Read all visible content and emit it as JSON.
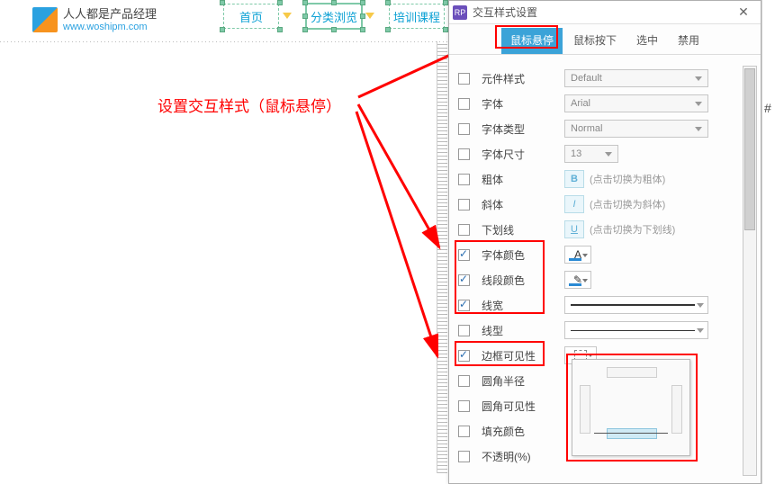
{
  "brand": {
    "title": "人人都是产品经理",
    "url": "www.woshipm.com"
  },
  "nav": {
    "items": [
      {
        "label": "首页"
      },
      {
        "label": "分类浏览",
        "selected": true
      },
      {
        "label": "培训课程"
      }
    ]
  },
  "annotation": "设置交互样式（鼠标悬停）",
  "dialog": {
    "app_badge": "RP",
    "title": "交互样式设置",
    "tabs": {
      "hover": "鼠标悬停",
      "mousedown": "鼠标按下",
      "selected": "选中",
      "disabled": "禁用"
    },
    "props": {
      "widget_style": {
        "label": "元件样式",
        "value": "Default"
      },
      "font_family": {
        "label": "字体",
        "value": "Arial"
      },
      "font_type": {
        "label": "字体类型",
        "value": "Normal"
      },
      "font_size": {
        "label": "字体尺寸",
        "value": "13"
      },
      "bold": {
        "label": "粗体",
        "btn": "B",
        "hint": "(点击切换为粗体)"
      },
      "italic": {
        "label": "斜体",
        "btn": "I",
        "hint": "(点击切换为斜体)"
      },
      "underline": {
        "label": "下划线",
        "btn": "U",
        "hint": "(点击切换为下划线)"
      },
      "font_color": {
        "label": "字体颜色",
        "glyph": "A"
      },
      "line_color": {
        "label": "线段颜色",
        "glyph": "✎"
      },
      "line_width": {
        "label": "线宽"
      },
      "line_style": {
        "label": "线型"
      },
      "border_visibility": {
        "label": "边框可见性"
      },
      "corner_radius": {
        "label": "圆角半径"
      },
      "corner_visibility": {
        "label": "圆角可见性"
      },
      "fill_color": {
        "label": "填充颜色"
      },
      "opacity": {
        "label": "不透明(%)"
      }
    }
  },
  "hash": "#"
}
